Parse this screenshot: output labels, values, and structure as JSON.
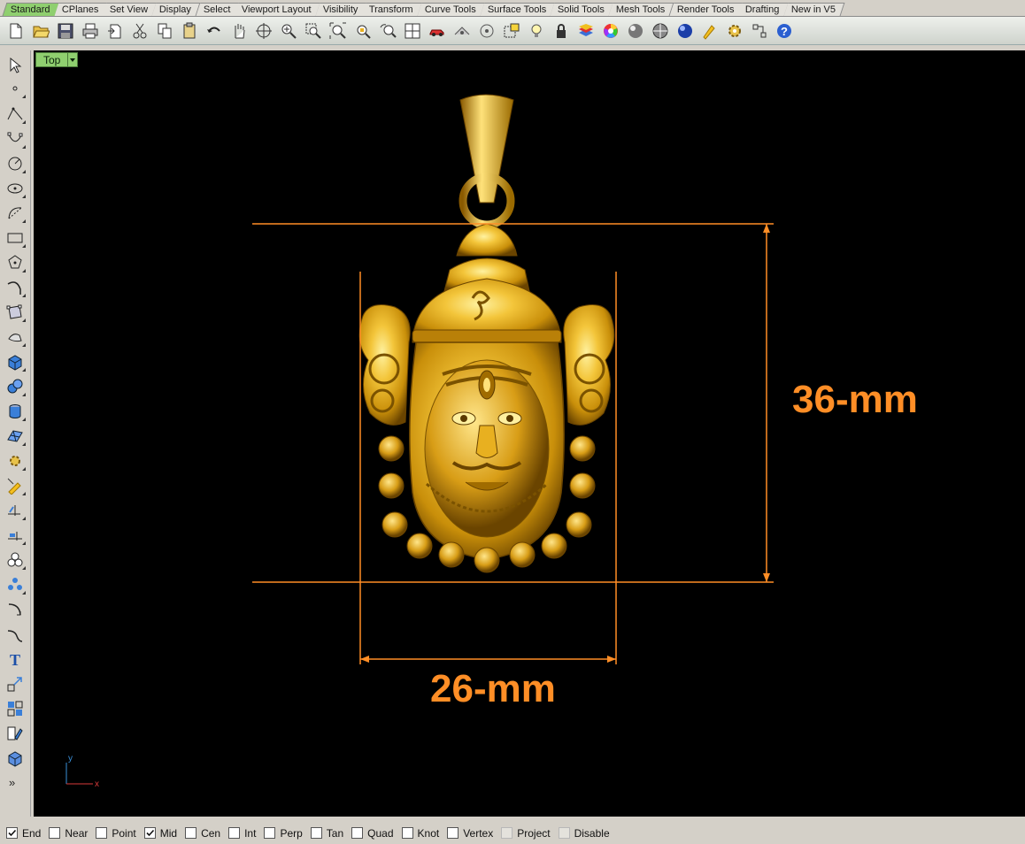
{
  "tabs": [
    {
      "label": "Standard",
      "active": true
    },
    {
      "label": "CPlanes"
    },
    {
      "label": "Set View"
    },
    {
      "label": "Display"
    },
    {
      "label": "Select"
    },
    {
      "label": "Viewport Layout"
    },
    {
      "label": "Visibility"
    },
    {
      "label": "Transform"
    },
    {
      "label": "Curve Tools"
    },
    {
      "label": "Surface Tools"
    },
    {
      "label": "Solid Tools"
    },
    {
      "label": "Mesh Tools"
    },
    {
      "label": "Render Tools"
    },
    {
      "label": "Drafting"
    },
    {
      "label": "New in V5"
    }
  ],
  "toolbar_icons": [
    "new-file-icon",
    "open-folder-icon",
    "save-icon",
    "print-icon",
    "import-icon",
    "cut-icon",
    "copy-icon",
    "paste-icon",
    "undo-icon",
    "pan-hand-icon",
    "rotate-view-icon",
    "zoom-dynamic-icon",
    "zoom-window-icon",
    "zoom-extents-icon",
    "zoom-selected-icon",
    "undo-view-icon",
    "four-viewports-icon",
    "car-render-icon",
    "named-views-icon",
    "point-filter-icon",
    "select-window-icon",
    "light-bulb-icon",
    "lock-icon",
    "layer-icon",
    "color-wheel-icon",
    "shaded-display-icon",
    "render-preview-icon",
    "render-icon",
    "tool-options-icon",
    "gear-settings-icon",
    "grid-snap-icon",
    "help-icon"
  ],
  "left_tools": [
    "select-arrow-icon",
    "point-icon",
    "polyline-icon",
    "curve-control-points-icon",
    "circle-icon",
    "ellipse-icon",
    "arc-icon",
    "rectangle-icon",
    "polygon-icon",
    "curve-freeform-icon",
    "surface-from-points-icon",
    "extrude-surface-icon",
    "box-solid-icon",
    "boolean-union-icon",
    "cylinder-icon",
    "mesh-plane-icon",
    "gear-transform-icon",
    "analyze-icon",
    "trim-icon",
    "split-icon",
    "group-icon",
    "array-icon",
    "fillet-curve-icon",
    "blend-curve-icon",
    "text-icon",
    "scale-icon",
    "align-icon",
    "properties-icon",
    "box-shaded-icon"
  ],
  "viewport": {
    "title": "Top",
    "dim_height_label": "36-mm",
    "dim_width_label": "26-mm",
    "axis_y_label": "y",
    "axis_x_label": "x",
    "dimension_color": "#ff8e26",
    "model_color": "#e8b020"
  },
  "osnaps": [
    {
      "label": "End",
      "checked": true
    },
    {
      "label": "Near",
      "checked": false
    },
    {
      "label": "Point",
      "checked": false
    },
    {
      "label": "Mid",
      "checked": true
    },
    {
      "label": "Cen",
      "checked": false
    },
    {
      "label": "Int",
      "checked": false
    },
    {
      "label": "Perp",
      "checked": false
    },
    {
      "label": "Tan",
      "checked": false
    },
    {
      "label": "Quad",
      "checked": false
    },
    {
      "label": "Knot",
      "checked": false
    },
    {
      "label": "Vertex",
      "checked": false
    },
    {
      "label": "Project",
      "checked": false,
      "disabled": true
    },
    {
      "label": "Disable",
      "checked": false,
      "disabled": true
    }
  ],
  "more_tools_glyph": "»"
}
